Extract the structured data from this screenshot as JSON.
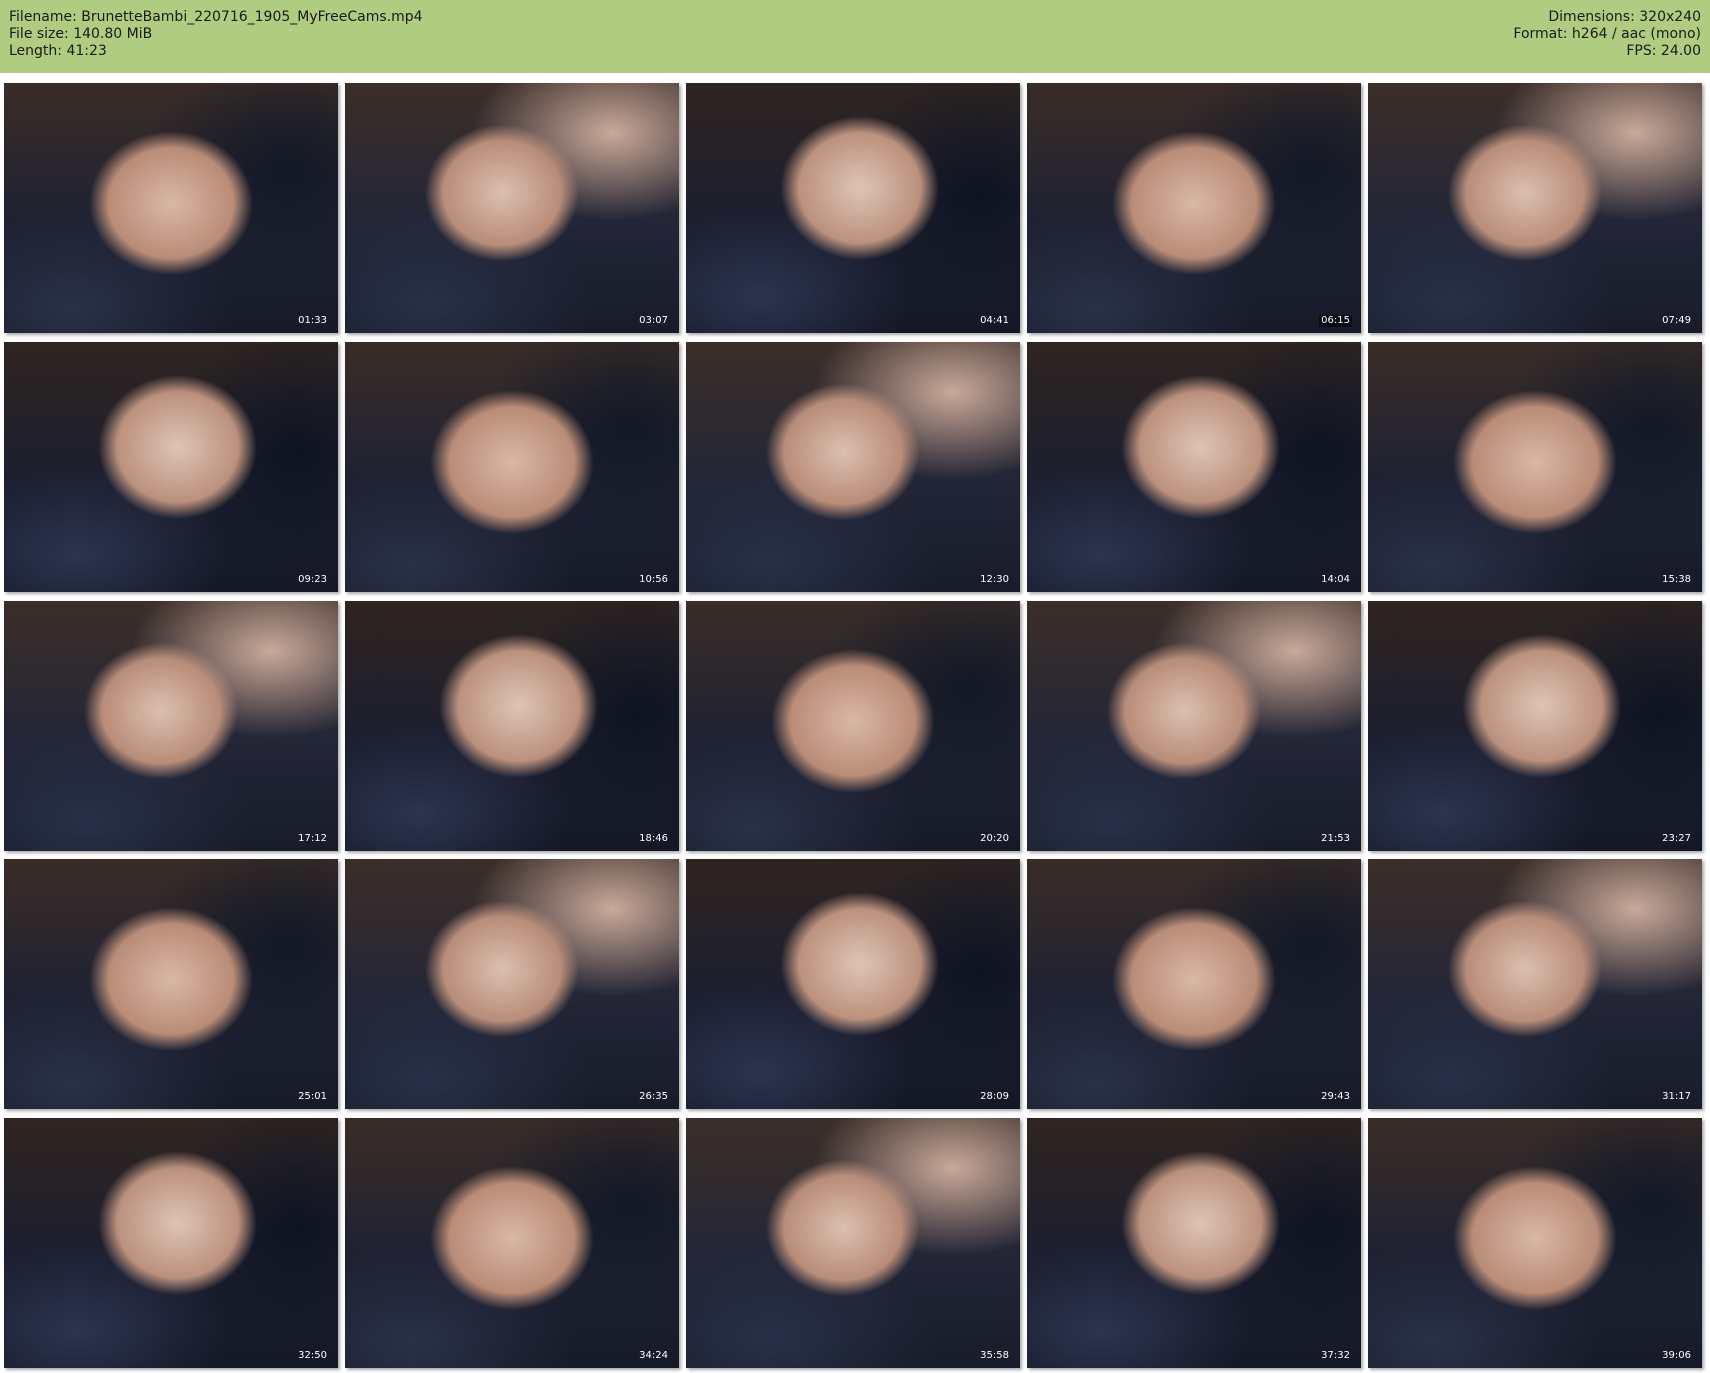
{
  "header": {
    "filename": "Filename: BrunetteBambi_220716_1905_MyFreeCams.mp4",
    "file_size": "File size: 140.80 MiB",
    "length": "Length: 41:23",
    "dimensions": "Dimensions: 320x240",
    "format": "Format: h264 / aac (mono)",
    "fps": "FPS: 24.00"
  },
  "thumbnails": [
    {
      "timestamp": "01:33"
    },
    {
      "timestamp": "03:07"
    },
    {
      "timestamp": "04:41"
    },
    {
      "timestamp": "06:15"
    },
    {
      "timestamp": "07:49"
    },
    {
      "timestamp": "09:23"
    },
    {
      "timestamp": "10:56"
    },
    {
      "timestamp": "12:30"
    },
    {
      "timestamp": "14:04"
    },
    {
      "timestamp": "15:38"
    },
    {
      "timestamp": "17:12"
    },
    {
      "timestamp": "18:46"
    },
    {
      "timestamp": "20:20"
    },
    {
      "timestamp": "21:53"
    },
    {
      "timestamp": "23:27"
    },
    {
      "timestamp": "25:01"
    },
    {
      "timestamp": "26:35"
    },
    {
      "timestamp": "28:09"
    },
    {
      "timestamp": "29:43"
    },
    {
      "timestamp": "31:17"
    },
    {
      "timestamp": "32:50"
    },
    {
      "timestamp": "34:24"
    },
    {
      "timestamp": "35:58"
    },
    {
      "timestamp": "37:32"
    },
    {
      "timestamp": "39:06"
    }
  ]
}
